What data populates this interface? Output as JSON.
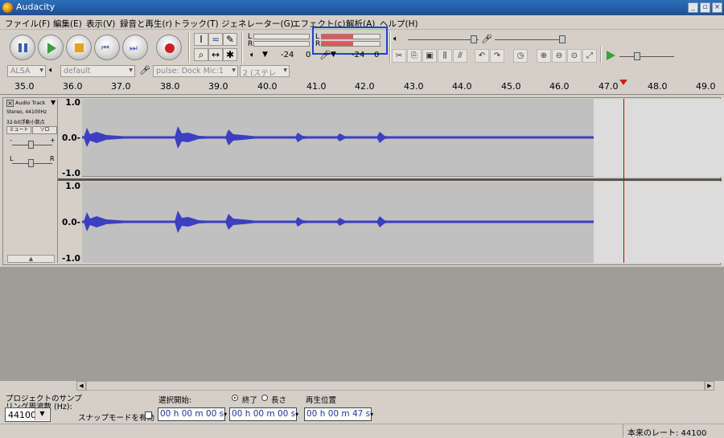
{
  "window": {
    "title": "Audacity",
    "buttons": [
      "_",
      "▫",
      "×"
    ]
  },
  "menu": [
    "ファイル(F)",
    "編集(E)",
    "表示(V)",
    "録音と再生(r)",
    "トラック(T)",
    "ジェネレーター(G)",
    "エフェクト(c)",
    "解析(A)",
    "ヘルプ(H)"
  ],
  "meters": {
    "out_L": "L",
    "out_R": "R",
    "in_L": "L",
    "in_R": "R",
    "scale_minus24": "-24",
    "scale_0": "0"
  },
  "device": {
    "host": "ALSA",
    "output": "default",
    "input": "pulse: Dock Mic:1",
    "channels": "2 (ステレ"
  },
  "ruler": [
    "35.0",
    "36.0",
    "37.0",
    "38.0",
    "39.0",
    "40.0",
    "41.0",
    "42.0",
    "43.0",
    "44.0",
    "45.0",
    "46.0",
    "47.0",
    "48.0",
    "49.0"
  ],
  "track": {
    "name": "Audio Track",
    "info1": "Stereo, 44100Hz",
    "info2": "32-bit浮動小数点",
    "mute": "ミュート",
    "solo": "ソロ",
    "pan_L": "L",
    "pan_R": "R",
    "gain_minus": "-",
    "gain_plus": "+"
  },
  "amp_labels": [
    "1.0",
    "0.0-",
    "-1.0"
  ],
  "bottom": {
    "rate_label_1": "プロジェクトのサンプ",
    "rate_label_2": "リング周波数 (Hz):",
    "rate_value": "44100",
    "snap_label": "スナップモードを有効",
    "sel_start_label": "選択開始:",
    "end_label": "終了",
    "length_label": "長さ",
    "pos_label": "再生位置",
    "sel_start": "00 h 00 m 00 s",
    "sel_end": "00 h 00 m 00 s",
    "position": "00 h 00 m 47 s"
  },
  "status": {
    "actual_rate": "本来のレート: 44100"
  },
  "colors": {
    "waveform": "#3c3fc2",
    "bg_wave": "#c0c0c0",
    "cursor": "#cc0000",
    "meter": "#e05858"
  }
}
